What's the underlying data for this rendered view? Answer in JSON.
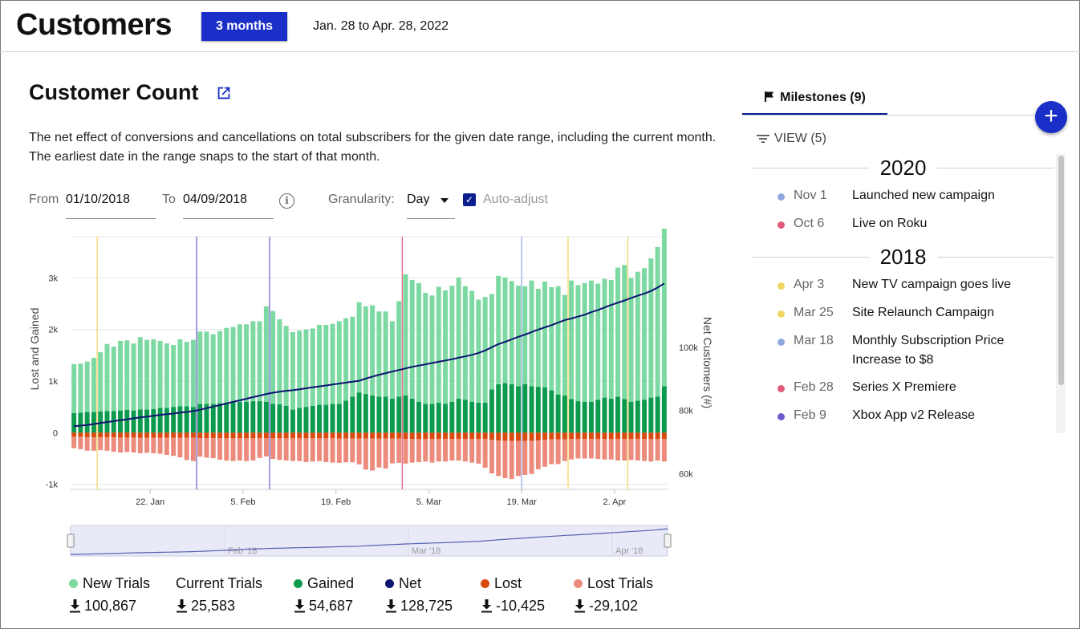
{
  "header": {
    "title": "Customers",
    "range_button": "3 months",
    "date_range": "Jan. 28 to Apr. 28, 2022"
  },
  "section": {
    "title": "Customer Count",
    "description": "The net effect of conversions and cancellations on total subscribers for the given date range, including the current month. The earliest date in the range snaps to the start of that month."
  },
  "controls": {
    "from_label": "From",
    "from_value": "01/10/2018",
    "to_label": "To",
    "to_value": "04/09/2018",
    "granularity_label": "Granularity:",
    "granularity_value": "Day",
    "auto_adjust_label": "Auto-adjust",
    "auto_adjust_checked": true
  },
  "chart_data": {
    "type": "bar",
    "ylabel_left": "Lost and Gained",
    "ylabel_right": "Net Customers (#)",
    "y_ticks_left": [
      "3k",
      "2k",
      "1k",
      "0",
      "-1k"
    ],
    "y_ticks_right": [
      "100k",
      "80k",
      "60k"
    ],
    "x_ticks": [
      "22. Jan",
      "5. Feb",
      "19. Feb",
      "5. Mar",
      "19. Mar",
      "2. Apr"
    ],
    "ylim_left": [
      -1100,
      3800
    ],
    "ylim_right": [
      55000,
      135000
    ],
    "milestone_lines": [
      {
        "day": 4,
        "color": "#f2d462"
      },
      {
        "day": 19,
        "color": "#6a5acd"
      },
      {
        "day": 30,
        "color": "#6a5acd"
      },
      {
        "day": 50,
        "color": "#e05a7a"
      },
      {
        "day": 68,
        "color": "#8fa8e0"
      },
      {
        "day": 75,
        "color": "#f2d462"
      },
      {
        "day": 84,
        "color": "#f2d462"
      }
    ],
    "series": [
      {
        "name": "New Trials",
        "color": "#7dd9a2",
        "values": [
          950,
          950,
          980,
          1050,
          1150,
          1300,
          1250,
          1350,
          1350,
          1300,
          1400,
          1350,
          1350,
          1300,
          1250,
          1200,
          1300,
          1250,
          1300,
          1400,
          1400,
          1350,
          1400,
          1450,
          1450,
          1500,
          1500,
          1550,
          1550,
          1850,
          1800,
          1650,
          1550,
          1500,
          1500,
          1500,
          1500,
          1550,
          1550,
          1550,
          1600,
          1600,
          1550,
          1750,
          1700,
          1750,
          1650,
          1650,
          1500,
          1850,
          2350,
          2300,
          2300,
          2150,
          2100,
          2250,
          2200,
          2250,
          2350,
          2200,
          2150,
          2000,
          2050,
          1850,
          2100,
          2050,
          2000,
          1950,
          1900,
          2050,
          1900,
          2050,
          2000,
          2100,
          1950,
          2300,
          2250,
          2300,
          2350,
          2250,
          2300,
          2300,
          2500,
          2600,
          2400,
          2500,
          2550,
          2700,
          2900,
          3100
        ]
      },
      {
        "name": "Gained",
        "color": "#0c9b4e",
        "values": [
          380,
          390,
          400,
          400,
          410,
          420,
          420,
          430,
          440,
          430,
          450,
          450,
          460,
          480,
          480,
          500,
          510,
          510,
          500,
          560,
          560,
          560,
          570,
          580,
          600,
          600,
          600,
          610,
          610,
          600,
          560,
          550,
          520,
          450,
          480,
          500,
          520,
          540,
          540,
          560,
          560,
          620,
          700,
          780,
          750,
          720,
          700,
          700,
          660,
          700,
          720,
          660,
          600,
          560,
          560,
          580,
          560,
          600,
          660,
          640,
          600,
          580,
          580,
          840,
          940,
          960,
          940,
          900,
          940,
          900,
          890,
          880,
          820,
          740,
          720,
          650,
          610,
          600,
          600,
          640,
          680,
          660,
          700,
          650,
          600,
          620,
          640,
          680,
          700,
          900
        ]
      },
      {
        "name": "Lost",
        "color": "#d94a0f",
        "values": [
          -80,
          -80,
          -90,
          -90,
          -90,
          -90,
          -90,
          -95,
          -95,
          -95,
          -100,
          -100,
          -100,
          -100,
          -100,
          -100,
          -100,
          -100,
          -100,
          -105,
          -105,
          -105,
          -105,
          -110,
          -110,
          -110,
          -110,
          -110,
          -110,
          -110,
          -110,
          -110,
          -110,
          -110,
          -110,
          -110,
          -110,
          -110,
          -110,
          -110,
          -115,
          -115,
          -115,
          -115,
          -115,
          -115,
          -115,
          -115,
          -115,
          -115,
          -120,
          -120,
          -120,
          -120,
          -120,
          -120,
          -120,
          -120,
          -120,
          -120,
          -120,
          -120,
          -120,
          -140,
          -150,
          -160,
          -160,
          -160,
          -160,
          -160,
          -150,
          -140,
          -130,
          -130,
          -130,
          -120,
          -120,
          -120,
          -120,
          -120,
          -120,
          -120,
          -120,
          -120,
          -120,
          -120,
          -120,
          -120,
          -120,
          -120
        ]
      },
      {
        "name": "Lost Trials",
        "color": "#ec8b7c",
        "values": [
          -220,
          -240,
          -260,
          -260,
          -250,
          -260,
          -280,
          -290,
          -280,
          -290,
          -300,
          -290,
          -300,
          -310,
          -330,
          -350,
          -380,
          -430,
          -450,
          -360,
          -380,
          -390,
          -420,
          -430,
          -440,
          -430,
          -440,
          -430,
          -380,
          -350,
          -400,
          -420,
          -430,
          -440,
          -440,
          -460,
          -450,
          -440,
          -460,
          -470,
          -470,
          -460,
          -460,
          -500,
          -600,
          -620,
          -560,
          -580,
          -480,
          -470,
          -480,
          -460,
          -450,
          -440,
          -460,
          -440,
          -440,
          -420,
          -420,
          -440,
          -460,
          -480,
          -560,
          -650,
          -690,
          -720,
          -740,
          -680,
          -660,
          -640,
          -560,
          -520,
          -480,
          -480,
          -420,
          -400,
          -380,
          -380,
          -380,
          -390,
          -400,
          -400,
          -420,
          -420,
          -410,
          -420,
          -430,
          -440,
          -420,
          -440
        ]
      },
      {
        "name": "Net",
        "color": "#0b1470",
        "values": [
          75000,
          75200,
          75400,
          75700,
          76000,
          76300,
          76600,
          76900,
          77200,
          77500,
          77800,
          78000,
          78300,
          78600,
          78800,
          79000,
          79300,
          79500,
          79800,
          80200,
          80700,
          81200,
          81700,
          82200,
          82700,
          83200,
          83700,
          84200,
          84700,
          85200,
          85600,
          85900,
          86200,
          86400,
          86700,
          87000,
          87300,
          87600,
          87900,
          88200,
          88500,
          88800,
          89100,
          89400,
          90100,
          90700,
          91300,
          91800,
          92300,
          92800,
          93300,
          93800,
          94200,
          94600,
          95000,
          95400,
          95800,
          96200,
          96700,
          97100,
          97600,
          98200,
          99000,
          100000,
          101000,
          101700,
          102500,
          103300,
          104000,
          104800,
          105600,
          106300,
          107000,
          107800,
          108600,
          109100,
          109700,
          110300,
          111100,
          111800,
          112600,
          113400,
          114100,
          114800,
          115600,
          116300,
          117000,
          117800,
          118900,
          120200
        ]
      }
    ],
    "navigator": {
      "labels": [
        "Feb '18",
        "Mar '18",
        "Apr '18"
      ]
    }
  },
  "legend": [
    {
      "name": "New Trials",
      "value": "100,867",
      "color": "#7dd9a2",
      "dot": true
    },
    {
      "name": "Current Trials",
      "value": "25,583",
      "color": "",
      "dot": false
    },
    {
      "name": "Gained",
      "value": "54,687",
      "color": "#0c9b4e",
      "dot": true
    },
    {
      "name": "Net",
      "value": "128,725",
      "color": "#0b1470",
      "dot": true
    },
    {
      "name": "Lost",
      "value": "-10,425",
      "color": "#d94a0f",
      "dot": true
    },
    {
      "name": "Lost Trials",
      "value": "-29,102",
      "color": "#ec8b7c",
      "dot": true
    }
  ],
  "milestones": {
    "tab_label": "Milestones (9)",
    "view_label": "VIEW (5)",
    "groups": [
      {
        "year": "2020",
        "items": [
          {
            "date": "Nov 1",
            "text": "Launched new campaign",
            "color": "#8fa8e0"
          },
          {
            "date": "Oct 6",
            "text": "Live on Roku",
            "color": "#e05a7a"
          }
        ]
      },
      {
        "year": "2018",
        "items": [
          {
            "date": "Apr 3",
            "text": "New TV campaign goes live",
            "color": "#f2d462"
          },
          {
            "date": "Mar 25",
            "text": "Site Relaunch Campaign",
            "color": "#f2d462"
          },
          {
            "date": "Mar 18",
            "text": "Monthly Subscription Price Increase to $8",
            "color": "#8fa8e0"
          },
          {
            "date": "Feb 28",
            "text": "Series X Premiere",
            "color": "#e05a7a"
          },
          {
            "date": "Feb 9",
            "text": "Xbox App v2 Release",
            "color": "#6a5acd"
          }
        ]
      }
    ]
  }
}
